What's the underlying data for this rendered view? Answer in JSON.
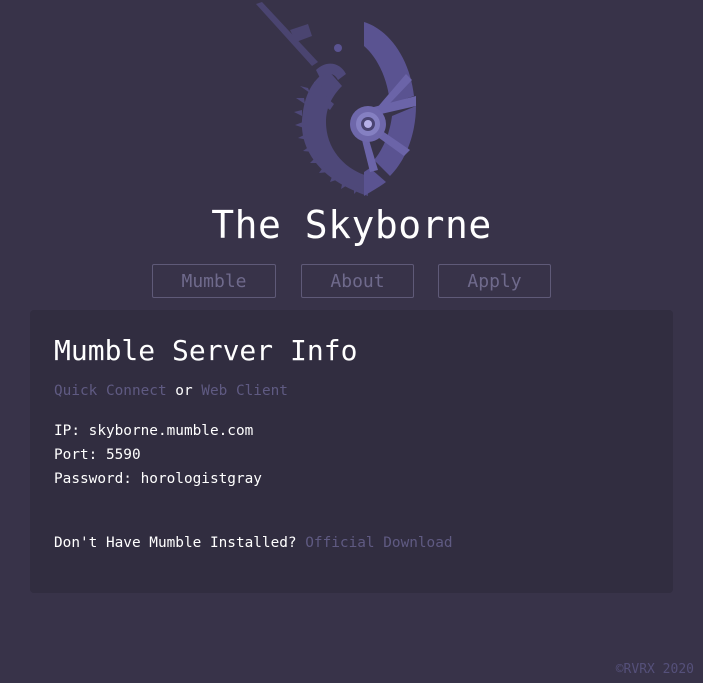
{
  "site": {
    "title": "The Skyborne"
  },
  "nav": {
    "items": [
      {
        "label": "Mumble"
      },
      {
        "label": "About"
      },
      {
        "label": "Apply"
      }
    ]
  },
  "card": {
    "title": "Mumble Server Info",
    "quick_connect": "Quick Connect",
    "or_text": " or ",
    "web_client": "Web Client",
    "ip_label": "IP: ",
    "ip_value": "skyborne.mumble.com",
    "port_label": "Port: ",
    "port_value": "5590",
    "password_label": "Password: ",
    "password_value": "horologistgray",
    "download_prompt": "Don't Have Mumble Installed? ",
    "download_link": "Official Download"
  },
  "footer": {
    "copyright": "©RVRX 2020"
  },
  "colors": {
    "background": "#383349",
    "card": "#312d40",
    "link": "#5f5a82",
    "button_border": "#5f5a78",
    "logo": "#5a5391"
  },
  "icons": {
    "logo": "skyborne-clockwork-emblem-icon"
  }
}
